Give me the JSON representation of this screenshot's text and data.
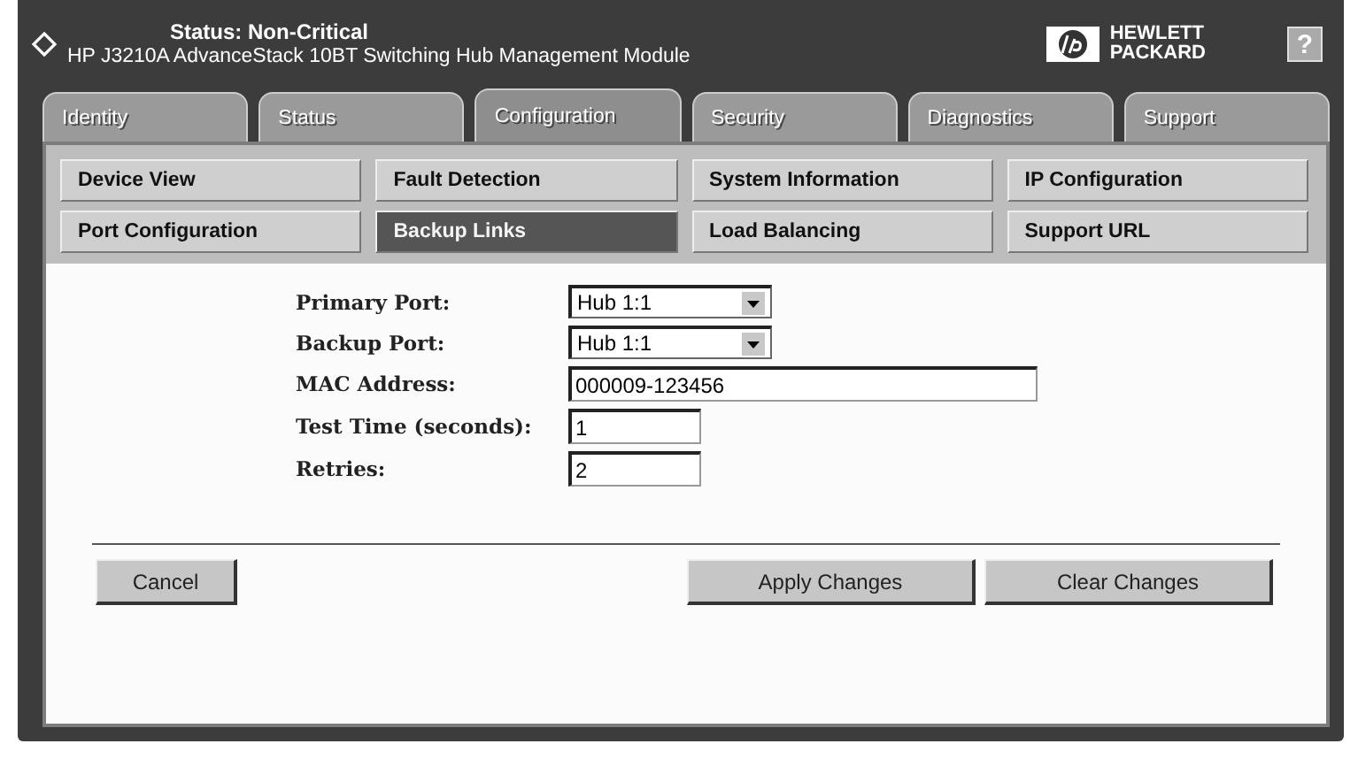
{
  "header": {
    "status": "Status: Non-Critical",
    "title": "HP J3210A AdvanceStack 10BT Switching Hub Management Module",
    "logo_line1": "HEWLETT",
    "logo_line2": "PACKARD",
    "help": "?"
  },
  "tabs": [
    {
      "label": "Identity",
      "selected": false
    },
    {
      "label": "Status",
      "selected": false
    },
    {
      "label": "Configuration",
      "selected": true
    },
    {
      "label": "Security",
      "selected": false
    },
    {
      "label": "Diagnostics",
      "selected": false
    },
    {
      "label": "Support",
      "selected": false
    }
  ],
  "subnav": [
    {
      "label": "Device View",
      "selected": false
    },
    {
      "label": "Fault Detection",
      "selected": false
    },
    {
      "label": "System Information",
      "selected": false
    },
    {
      "label": "IP Configuration",
      "selected": false
    },
    {
      "label": "Port Configuration",
      "selected": false
    },
    {
      "label": "Backup Links",
      "selected": true
    },
    {
      "label": "Load Balancing",
      "selected": false
    },
    {
      "label": "Support URL",
      "selected": false
    }
  ],
  "form": [
    {
      "label": "Primary Port:",
      "kind": "select",
      "value": "Hub 1:1"
    },
    {
      "label": "Backup Port:",
      "kind": "select",
      "value": "Hub 1:1"
    },
    {
      "label": "MAC Address:",
      "kind": "wide",
      "value": "000009-123456"
    },
    {
      "label": "Test Time (seconds):",
      "kind": "short",
      "value": "1"
    },
    {
      "label": "Retries:",
      "kind": "short",
      "value": "2"
    }
  ],
  "buttons": {
    "cancel": "Cancel",
    "apply": "Apply Changes",
    "clear": "Clear Changes"
  }
}
